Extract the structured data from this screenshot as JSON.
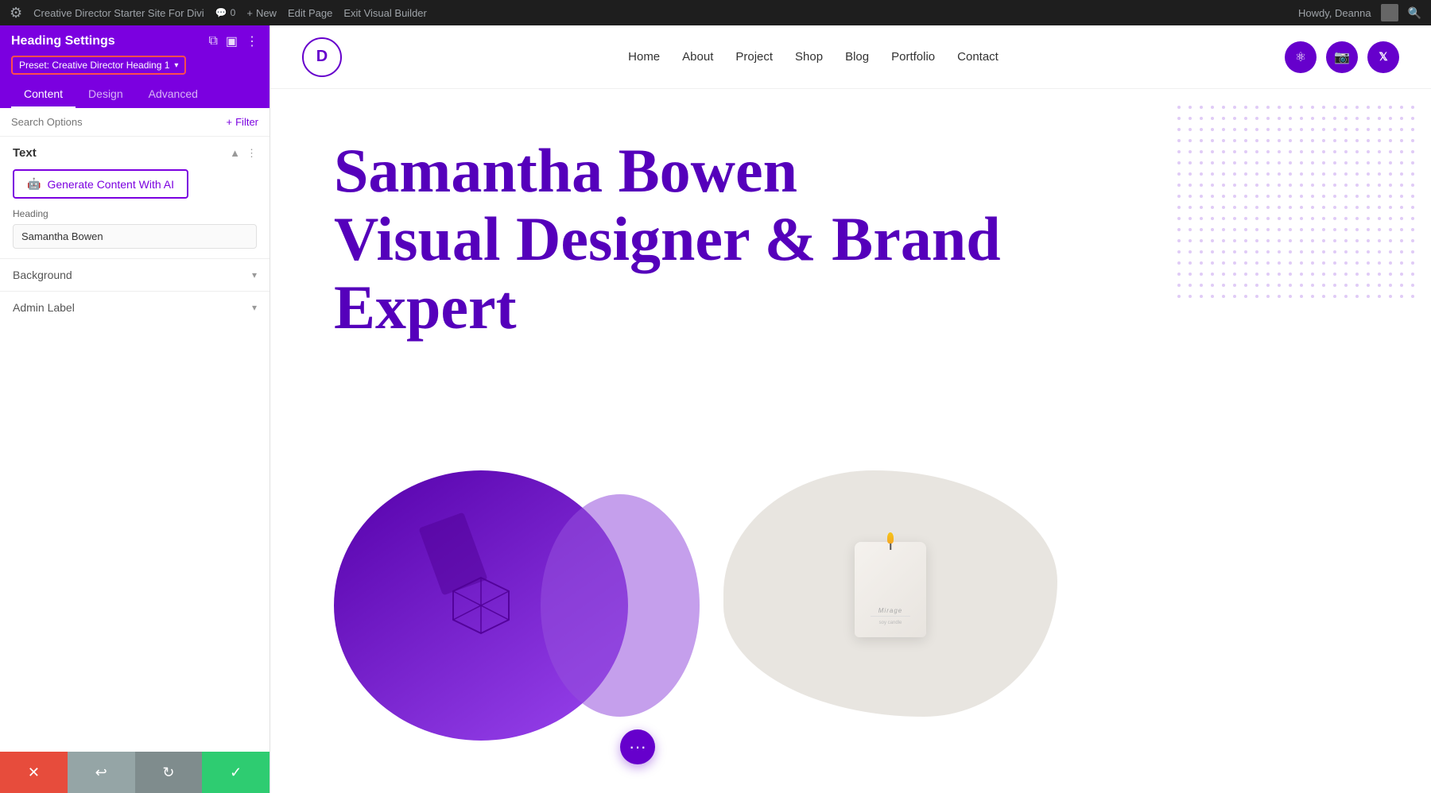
{
  "admin_bar": {
    "wp_icon": "W",
    "site_name": "Creative Director Starter Site For Divi",
    "comments": "0",
    "new_label": "New",
    "edit_page": "Edit Page",
    "exit_builder": "Exit Visual Builder",
    "howdy": "Howdy, Deanna",
    "search_label": "Search"
  },
  "left_panel": {
    "title": "Heading Settings",
    "preset_label": "Preset: Creative Director Heading 1",
    "tabs": [
      {
        "id": "content",
        "label": "Content",
        "active": true
      },
      {
        "id": "design",
        "label": "Design",
        "active": false
      },
      {
        "id": "advanced",
        "label": "Advanced",
        "active": false
      }
    ],
    "search_placeholder": "Search Options",
    "filter_label": "Filter",
    "text_section": {
      "title": "Text",
      "ai_button_label": "Generate Content With AI",
      "heading_label": "Heading",
      "heading_value": "Samantha Bowen"
    },
    "background_section": {
      "title": "Background"
    },
    "admin_label_section": {
      "title": "Admin Label"
    },
    "bottom_buttons": {
      "cancel": "✕",
      "undo": "↩",
      "redo": "↻",
      "save": "✓"
    }
  },
  "canvas": {
    "nav": {
      "logo_letter": "D",
      "links": [
        "Home",
        "About",
        "Project",
        "Shop",
        "Blog",
        "Portfolio",
        "Contact"
      ],
      "social": [
        "❋",
        "◎",
        "✕"
      ]
    },
    "hero": {
      "line1": "Samantha Bowen",
      "line2": "Visual Designer & Brand",
      "line3": "Expert"
    }
  }
}
